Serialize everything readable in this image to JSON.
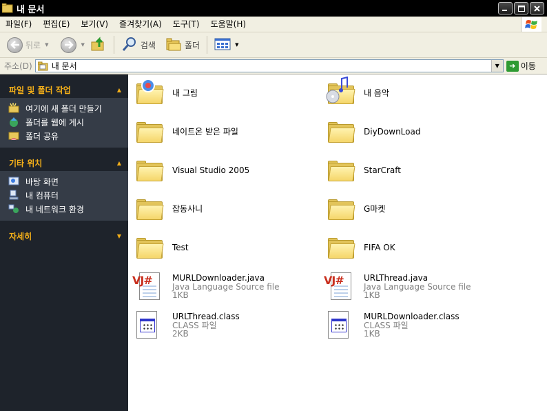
{
  "window": {
    "title": "내 문서"
  },
  "menu": {
    "items": [
      "파일(F)",
      "편집(E)",
      "보기(V)",
      "즐겨찾기(A)",
      "도구(T)",
      "도움말(H)"
    ]
  },
  "toolbar": {
    "back_label": "뒤로",
    "search_label": "검색",
    "folders_label": "폴더"
  },
  "address": {
    "label": "주소(D)",
    "value": "내 문서",
    "go_label": "이동"
  },
  "tasks": [
    {
      "title": "파일 및 폴더 작업",
      "items": [
        "여기에 새 폴더 만들기",
        "폴더를 웹에 게시",
        "폴더 공유"
      ]
    },
    {
      "title": "기타 위치",
      "items": [
        "바탕 화면",
        "내 컴퓨터",
        "내 네트워크 환경"
      ]
    },
    {
      "title": "자세히",
      "items": []
    }
  ],
  "files": [
    {
      "name": "내 그림",
      "icon": "my-pictures-folder-icon"
    },
    {
      "name": "내 음악",
      "icon": "my-music-folder-icon"
    },
    {
      "name": "네이트온 받은 파일",
      "icon": "folder-icon"
    },
    {
      "name": "DiyDownLoad",
      "icon": "folder-icon"
    },
    {
      "name": "Visual Studio 2005",
      "icon": "folder-icon"
    },
    {
      "name": "StarCraft",
      "icon": "folder-icon"
    },
    {
      "name": "잡동사니",
      "icon": "folder-icon"
    },
    {
      "name": "G마켓",
      "icon": "folder-icon"
    },
    {
      "name": "Test",
      "icon": "folder-icon"
    },
    {
      "name": "FIFA OK",
      "icon": "folder-icon"
    },
    {
      "name": "MURLDownloader.java",
      "type": "Java Language Source file",
      "size": "1KB",
      "icon": "java-file-icon"
    },
    {
      "name": "URLThread.java",
      "type": "Java Language Source file",
      "size": "1KB",
      "icon": "java-file-icon"
    },
    {
      "name": "URLThread.class",
      "type": "CLASS 파일",
      "size": "2KB",
      "icon": "class-file-icon"
    },
    {
      "name": "MURLDownloader.class",
      "type": "CLASS 파일",
      "size": "1KB",
      "icon": "class-file-icon"
    }
  ]
}
